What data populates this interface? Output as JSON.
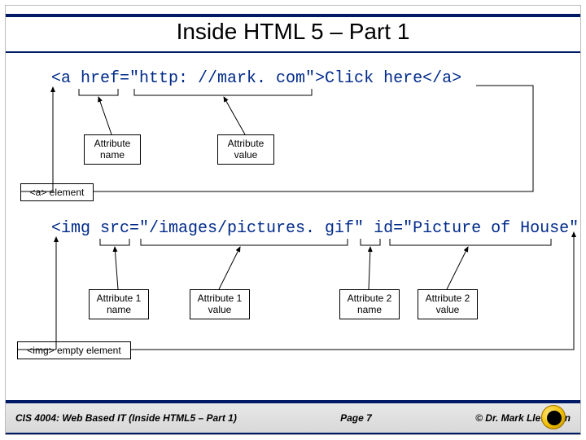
{
  "title": "Inside HTML 5 – Part 1",
  "example1": {
    "code": "<a href=\"http: //mark. com\">Click here</a>",
    "labels": {
      "attr_name": "Attribute\nname",
      "attr_value": "Attribute\nvalue",
      "element": "<a> element"
    }
  },
  "example2": {
    "code": "<img src=\"/images/pictures. gif\" id=\"Picture of House\"  />",
    "labels": {
      "attr1_name": "Attribute 1\nname",
      "attr1_value": "Attribute 1\nvalue",
      "attr2_name": "Attribute 2\nname",
      "attr2_value": "Attribute 2\nvalue",
      "element": "<img> empty element"
    }
  },
  "footer": {
    "course": "CIS 4004: Web Based IT (Inside HTML5 – Part 1)",
    "page": "Page 7",
    "author": "© Dr. Mark Llewellyn"
  }
}
